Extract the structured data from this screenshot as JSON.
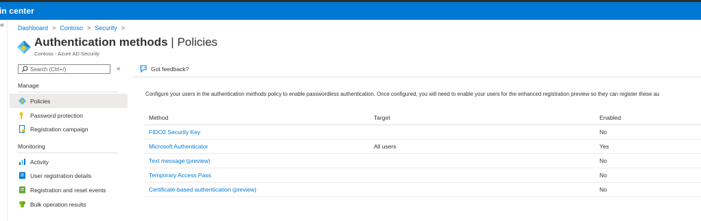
{
  "header": {
    "title": "in center"
  },
  "breadcrumb": {
    "items": [
      "Dashboard",
      "Contoso",
      "Security"
    ],
    "sep": ">"
  },
  "page": {
    "title_bold": "Authentication methods",
    "title_sep": " | ",
    "title_light": "Policies",
    "more": "...",
    "subtitle": "Contoso - Azure AD Security"
  },
  "search": {
    "placeholder": "Search (Ctrl+/)"
  },
  "nav": {
    "collapse": "«",
    "manage_label": "Manage",
    "monitoring_label": "Monitoring",
    "manage_items": [
      {
        "label": "Policies",
        "icon": "policy-icon",
        "selected": true
      },
      {
        "label": "Password protection",
        "icon": "key-icon"
      },
      {
        "label": "Registration campaign",
        "icon": "document-icon"
      }
    ],
    "monitoring_items": [
      {
        "label": "Activity",
        "icon": "chart-icon"
      },
      {
        "label": "User registration details",
        "icon": "user-details-icon"
      },
      {
        "label": "Registration and reset events",
        "icon": "events-icon"
      },
      {
        "label": "Bulk operation results",
        "icon": "bulk-icon"
      }
    ]
  },
  "toolbar": {
    "feedback": "Got feedback?"
  },
  "main": {
    "description": "Configure your users in the authentication methods policy to enable passwordless authentication. Once configured, you will need to enable your users for the enhanced registration preview so they can register these au",
    "columns": [
      "Method",
      "Target",
      "Enabled"
    ],
    "rows": [
      {
        "method": "FIDO2 Security Key",
        "target": "",
        "enabled": "No"
      },
      {
        "method": "Microsoft Authenticator",
        "target": "All users",
        "enabled": "Yes"
      },
      {
        "method": "Text message (preview)",
        "target": "",
        "enabled": "No"
      },
      {
        "method": "Temporary Access Pass",
        "target": "",
        "enabled": "No"
      },
      {
        "method": "Certificate-based authentication (preview)",
        "target": "",
        "enabled": "No"
      }
    ]
  },
  "colors": {
    "brand": "#0078d4",
    "selected_bg": "#edebe9",
    "text": "#323130"
  }
}
